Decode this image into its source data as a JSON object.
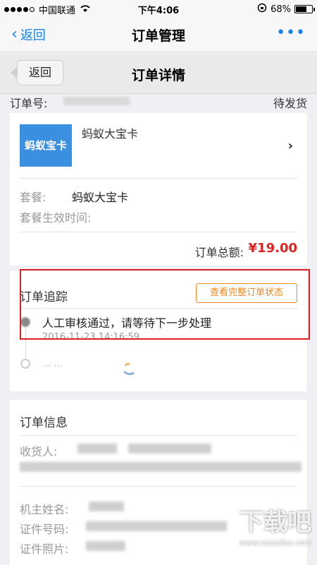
{
  "status_bar": {
    "carrier": "中国联通",
    "time": "下午4:06",
    "battery": "68%",
    "battery_level": 0.68
  },
  "nav": {
    "back_label": "返回",
    "title": "订单管理",
    "more_icon": "more-dots-icon"
  },
  "sub_header": {
    "back_label": "返回",
    "title": "订单详情"
  },
  "order": {
    "number_label": "订单号:",
    "status": "待发货"
  },
  "product": {
    "logo_text": "蚂蚁宝卡",
    "name": "蚂蚁大宝卡",
    "package_label": "套餐:",
    "package_value": "蚂蚁大宝卡",
    "effective_time_label": "套餐生效时间:",
    "total_label": "订单总额:",
    "total_value": "¥19.00"
  },
  "tracking": {
    "title": "订单追踪",
    "full_status_button": "查看完整订单状态",
    "events": [
      {
        "text": "人工审核通过，请等待下一步处理",
        "time": "2016-11-23 14:16:59"
      },
      {
        "text": "... ..."
      }
    ]
  },
  "order_info": {
    "title": "订单信息",
    "consignee_label": "收货人:",
    "owner_name_label": "机主姓名:",
    "id_number_label": "证件号码:",
    "id_photo_label": "证件照片:"
  },
  "watermark": {
    "text": "下载吧",
    "url": "www.xiazaiba.com"
  },
  "colors": {
    "accent": "#1a82e6",
    "price": "#e02424",
    "button_orange": "#f08a1c",
    "highlight_red": "#e02020"
  }
}
